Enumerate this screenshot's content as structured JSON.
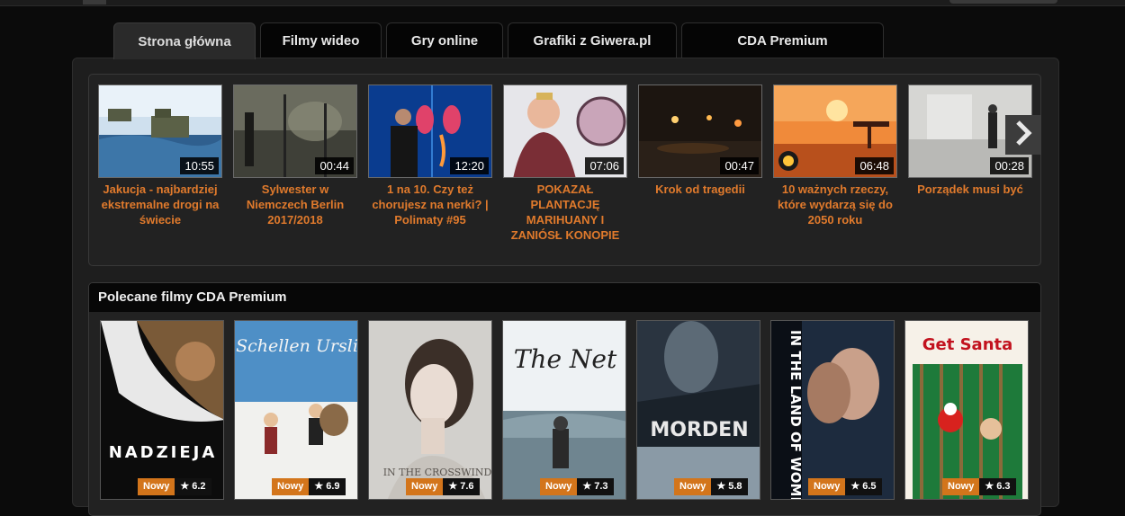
{
  "tabs": [
    {
      "label": "Strona główna",
      "active": true
    },
    {
      "label": "Filmy wideo",
      "active": false
    },
    {
      "label": "Gry online",
      "active": false
    },
    {
      "label": "Grafiki z Giwera.pl",
      "active": false
    },
    {
      "label": "CDA Premium",
      "active": false
    }
  ],
  "videos": [
    {
      "title": "Jakucja - najbardziej ekstremalne drogi na świecie",
      "duration": "10:55"
    },
    {
      "title": "Sylwester w Niemczech Berlin 2017/2018",
      "duration": "00:44"
    },
    {
      "title": "1 na 10. Czy też chorujesz na nerki? | Polimaty #95",
      "duration": "12:20"
    },
    {
      "title": "POKAZAŁ PLANTACJĘ MARIHUANY I ZANIÓSŁ KONOPIE",
      "duration": "07:06"
    },
    {
      "title": "Krok od tragedii",
      "duration": "00:47"
    },
    {
      "title": "10 ważnych rzeczy, które wydarzą się do 2050 roku",
      "duration": "06:48"
    },
    {
      "title": "Porządek musi być",
      "duration": "00:28"
    }
  ],
  "premium": {
    "heading": "Polecane filmy CDA Premium",
    "films": [
      {
        "poster_text": "NADZIEJA",
        "badge": "Nowy",
        "rating": "★ 6.2"
      },
      {
        "poster_text": "Schellen Ursli",
        "badge": "Nowy",
        "rating": "★ 6.9"
      },
      {
        "poster_text": "IN THE CROSSWIND",
        "badge": "Nowy",
        "rating": "★ 7.6"
      },
      {
        "poster_text": "The Net",
        "badge": "Nowy",
        "rating": "★ 7.3"
      },
      {
        "poster_text": "MORDEN",
        "badge": "Nowy",
        "rating": "★ 5.8"
      },
      {
        "poster_text": "IN THE LAND OF WOMEN",
        "badge": "Nowy",
        "rating": "★ 6.5"
      },
      {
        "poster_text": "Get Santa",
        "badge": "Nowy",
        "rating": "★ 6.3"
      }
    ]
  },
  "colors": {
    "accent": "#e07a2c",
    "badge": "#d3751b"
  }
}
